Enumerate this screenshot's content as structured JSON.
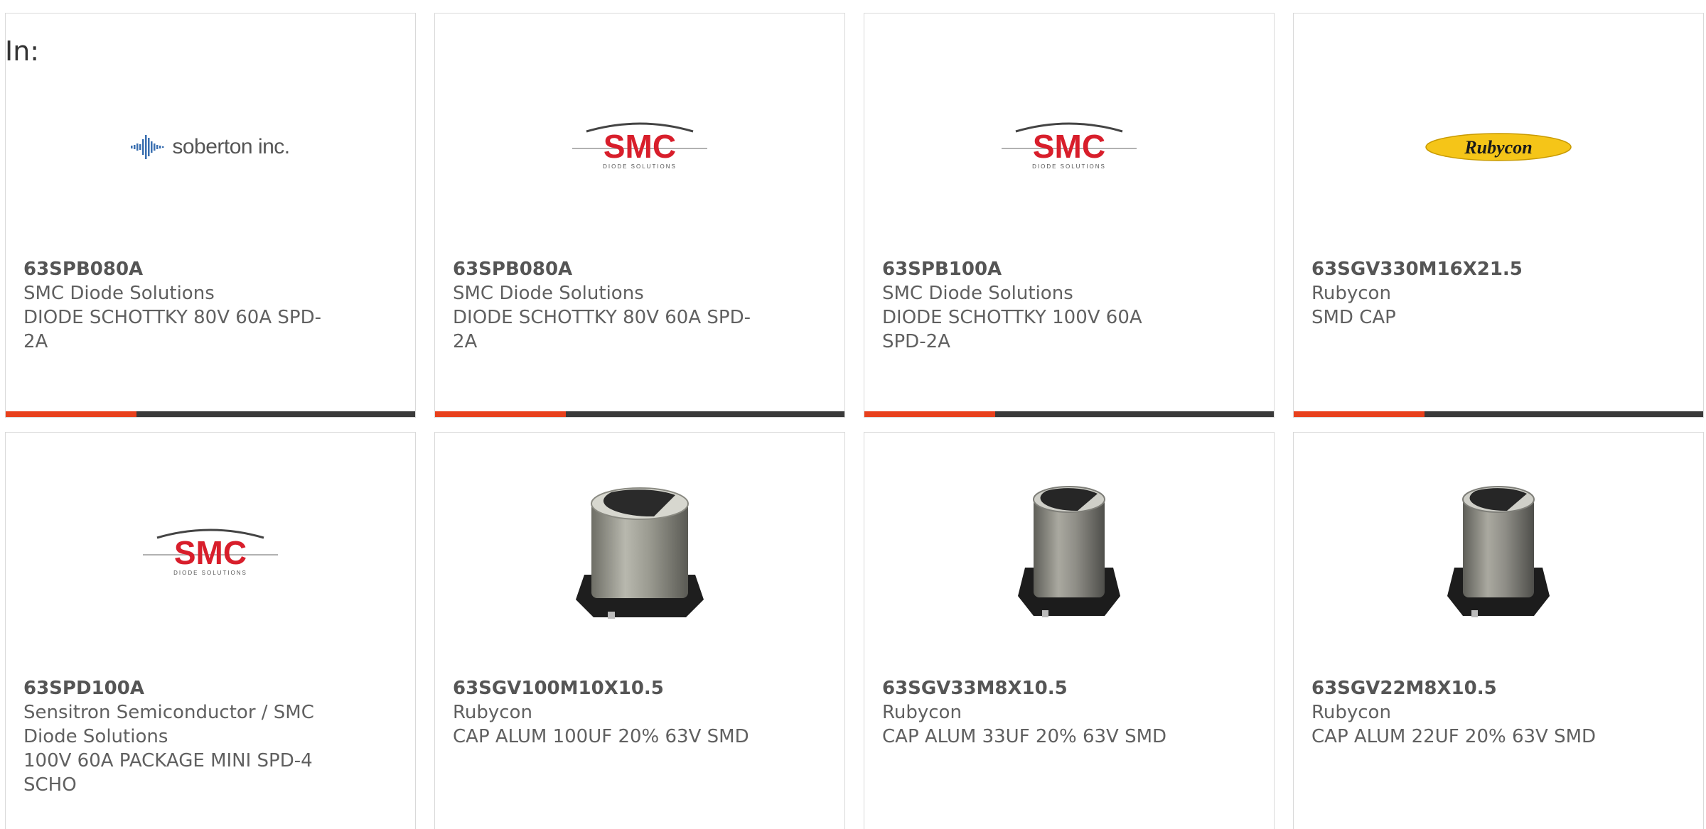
{
  "header": {
    "label": "In:"
  },
  "colors": {
    "accent": "#e8401c",
    "track": "#3a3a3a",
    "border": "#d9d9d9",
    "text": "#606060"
  },
  "progress_fraction": 0.32,
  "products": [
    {
      "part_number": "63SPB080A",
      "manufacturer": "SMC Diode Solutions",
      "description": "DIODE SCHOTTKY 80V 60A SPD-2A",
      "logo": "soberton-logo",
      "logo_text": "soberton inc."
    },
    {
      "part_number": "63SPB080A",
      "manufacturer": "SMC Diode Solutions",
      "description": "DIODE SCHOTTKY 80V 60A SPD-2A",
      "logo": "smc-logo",
      "logo_text": "SMC",
      "logo_subtext": "DIODE SOLUTIONS"
    },
    {
      "part_number": "63SPB100A",
      "manufacturer": "SMC Diode Solutions",
      "description": "DIODE SCHOTTKY 100V 60A SPD-2A",
      "logo": "smc-logo",
      "logo_text": "SMC",
      "logo_subtext": "DIODE SOLUTIONS"
    },
    {
      "part_number": "63SGV330M16X21.5",
      "manufacturer": "Rubycon",
      "description": "SMD CAP",
      "logo": "rubycon-logo",
      "logo_text": "Rubycon"
    },
    {
      "part_number": "63SPD100A",
      "manufacturer": "Sensitron Semiconductor / SMC Diode Solutions",
      "description": "100V 60A PACKAGE MINI SPD-4 SCHO",
      "logo": "smc-logo",
      "logo_text": "SMC",
      "logo_subtext": "DIODE SOLUTIONS"
    },
    {
      "part_number": "63SGV100M10X10.5",
      "manufacturer": "Rubycon",
      "description": "CAP ALUM 100UF 20% 63V SMD",
      "logo": "capacitor-image"
    },
    {
      "part_number": "63SGV33M8X10.5",
      "manufacturer": "Rubycon",
      "description": "CAP ALUM 33UF 20% 63V SMD",
      "logo": "capacitor-image"
    },
    {
      "part_number": "63SGV22M8X10.5",
      "manufacturer": "Rubycon",
      "description": "CAP ALUM 22UF 20% 63V SMD",
      "logo": "capacitor-image"
    }
  ]
}
